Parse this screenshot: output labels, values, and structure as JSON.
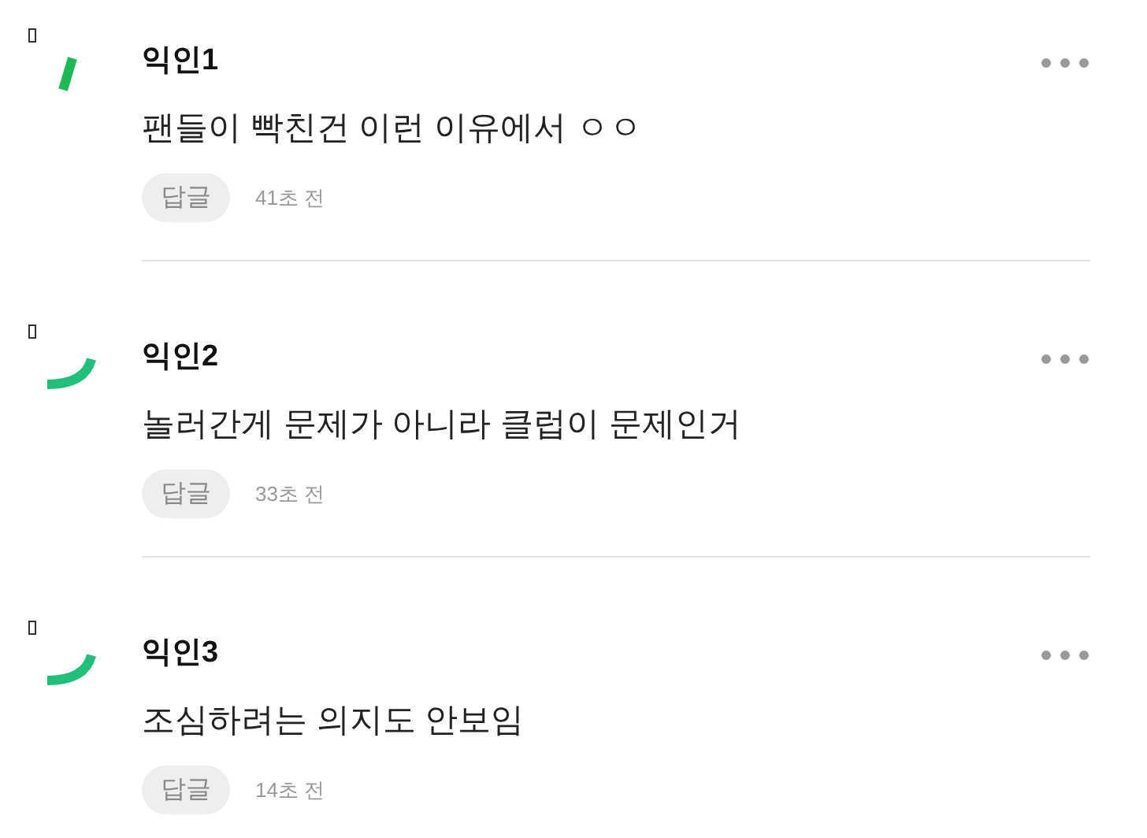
{
  "comments": [
    {
      "author": "익인1",
      "kind": "bar",
      "body": "팬들이 빡친건 이런 이유에서 ㅇㅇ",
      "reply_label": "답글",
      "time": "41초 전"
    },
    {
      "author": "익인2",
      "kind": "arc",
      "body": "놀러간게 문제가 아니라 클럽이 문제인거",
      "reply_label": "답글",
      "time": "33초 전"
    },
    {
      "author": "익인3",
      "kind": "arc",
      "body": "조심하려는 의지도 안보임",
      "reply_label": "답글",
      "time": "14초 전"
    }
  ]
}
